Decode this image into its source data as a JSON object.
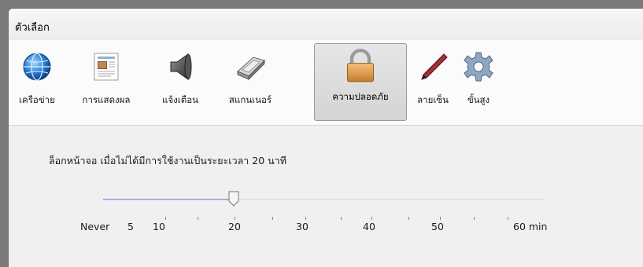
{
  "window": {
    "title": "ตัวเลือก"
  },
  "toolbar": {
    "items": [
      {
        "label": "เครือข่าย",
        "icon": "globe-icon",
        "active": false
      },
      {
        "label": "การแสดงผล",
        "icon": "display-document-icon",
        "active": false
      },
      {
        "label": "แจ้งเตือน",
        "icon": "speaker-icon",
        "active": false
      },
      {
        "label": "สแกนเนอร์",
        "icon": "scanner-icon",
        "active": false
      },
      {
        "label": "ความปลอดภัย",
        "icon": "padlock-icon",
        "active": true
      },
      {
        "label": "ลายเซ็น",
        "icon": "pen-icon",
        "active": false
      },
      {
        "label": "ขั้นสูง",
        "icon": "gear-icon",
        "active": false
      }
    ]
  },
  "security": {
    "lock_screen_text": "ล็อกหน้าจอ เมื่อไม่ได้มีการใช้งานเป็นระยะเวลา 20 นาที",
    "slider": {
      "value": 20,
      "unit": "min",
      "labels": [
        "Never",
        "5",
        "10",
        "20",
        "30",
        "40",
        "50",
        "60 min"
      ]
    }
  },
  "colors": {
    "slider_fill": "#b9a4e4",
    "active_tab_border": "#999999"
  }
}
